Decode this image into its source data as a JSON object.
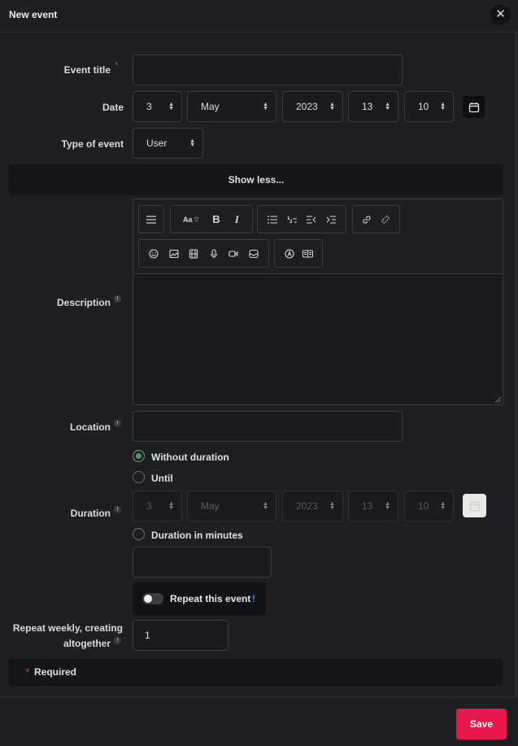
{
  "dialog": {
    "title": "New event",
    "close_label": "✕"
  },
  "form": {
    "event_title": {
      "label": "Event title",
      "value": "",
      "required_mark": "*"
    },
    "date": {
      "label": "Date",
      "day": "3",
      "month": "May",
      "year": "2023",
      "hour": "13",
      "minute": "10"
    },
    "type_of_event": {
      "label": "Type of event",
      "value": "User"
    },
    "show_less_label": "Show less...",
    "description": {
      "label": "Description",
      "info": "!",
      "value": ""
    },
    "location": {
      "label": "Location",
      "info": "!",
      "value": ""
    },
    "duration": {
      "label": "Duration",
      "info": "!",
      "options": [
        {
          "label": "Without duration",
          "checked": true
        },
        {
          "label": "Until",
          "checked": false
        },
        {
          "label": "Duration in minutes",
          "checked": false
        }
      ],
      "until": {
        "day": "3",
        "month": "May",
        "year": "2023",
        "hour": "13",
        "minute": "10"
      },
      "minutes_value": ""
    },
    "repeat": {
      "label": "Repeat this event",
      "info": "!",
      "enabled": false
    },
    "repeat_weekly": {
      "label_line1": "Repeat weekly, creating",
      "label_line2": "altogether",
      "info": "!",
      "value": "1"
    },
    "required_note": {
      "star": "*",
      "text": "Required"
    }
  },
  "footer": {
    "save_label": "Save"
  },
  "colors": {
    "accent": "#e8164d",
    "radio_checked": "#4f9a66",
    "required": "#e0263d",
    "info_blue": "#3d8bff"
  },
  "editor_toolbar": {
    "font_size_label": "Aa",
    "bold_label": "B",
    "italic_label": "I",
    "icons_row1": [
      "menu-icon",
      "font-size-icon",
      "bold-icon",
      "italic-icon",
      "unordered-list-icon",
      "ordered-list-icon",
      "outdent-icon",
      "indent-icon",
      "link-icon",
      "unlink-icon"
    ],
    "icons_row2": [
      "emoji-icon",
      "image-icon",
      "film-icon",
      "microphone-icon",
      "video-icon",
      "inbox-icon",
      "accessibility-check-icon",
      "html-icon"
    ]
  }
}
